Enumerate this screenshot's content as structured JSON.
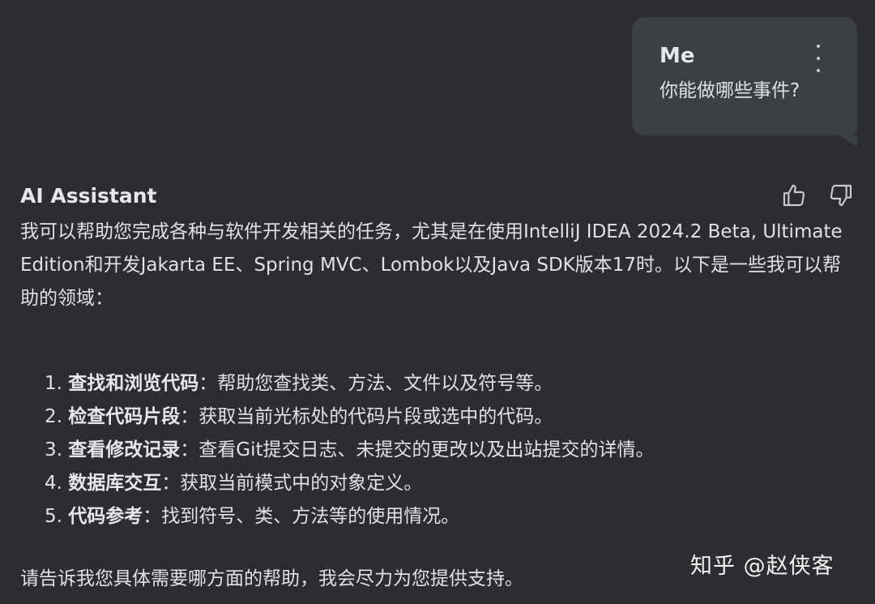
{
  "user_message": {
    "sender": "Me",
    "text": "你能做哪些事件?"
  },
  "assistant_message": {
    "sender": "AI Assistant",
    "intro": "我可以帮助您完成各种与软件开发相关的任务，尤其是在使用IntelliJ IDEA 2024.2 Beta, Ultimate Edition和开发Jakarta EE、Spring MVC、Lombok以及Java SDK版本17时。以下是一些我可以帮助的领域：",
    "items": [
      {
        "num": "1.",
        "term": "查找和浏览代码",
        "desc": "：帮助您查找类、方法、文件以及符号等。"
      },
      {
        "num": "2.",
        "term": "检查代码片段",
        "desc": "：获取当前光标处的代码片段或选中的代码。"
      },
      {
        "num": "3.",
        "term": "查看修改记录",
        "desc": "：查看Git提交日志、未提交的更改以及出站提交的详情。"
      },
      {
        "num": "4.",
        "term": "数据库交互",
        "desc": "：获取当前模式中的对象定义。"
      },
      {
        "num": "5.",
        "term": "代码参考",
        "desc": "：找到符号、类、方法等的使用情况。"
      }
    ],
    "outro": "请告诉我您具体需要哪方面的帮助，我会尽力为您提供支持。"
  },
  "icons": {
    "more": "more-vertical-icon",
    "like": "thumbs-up-icon",
    "dislike": "thumbs-down-icon"
  },
  "watermark": "知乎 @赵侠客",
  "colors": {
    "background": "#2b2d30",
    "bubble": "#3c3f44",
    "text": "#dfe1e5"
  }
}
